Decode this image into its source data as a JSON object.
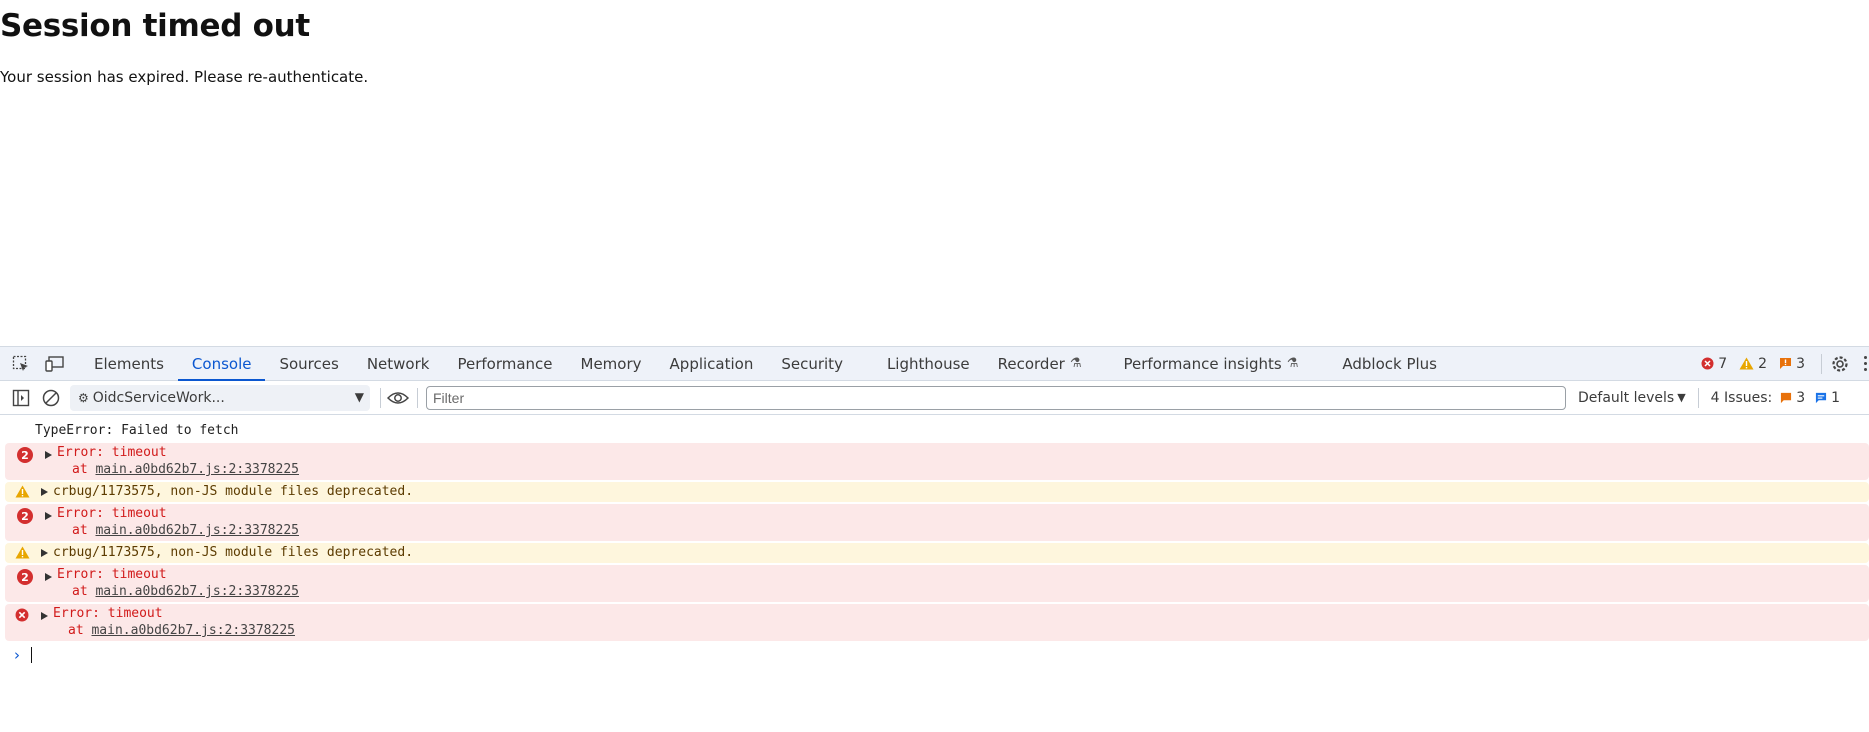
{
  "page": {
    "title": "Session timed out",
    "message": "Your session has expired. Please re-authenticate."
  },
  "devtools": {
    "tabs": [
      {
        "label": "Elements"
      },
      {
        "label": "Console",
        "active": true
      },
      {
        "label": "Sources"
      },
      {
        "label": "Network"
      },
      {
        "label": "Performance"
      },
      {
        "label": "Memory"
      },
      {
        "label": "Application"
      },
      {
        "label": "Security"
      },
      {
        "label": "Lighthouse"
      },
      {
        "label": "Recorder",
        "experimental": true
      },
      {
        "label": "Performance insights",
        "experimental": true
      },
      {
        "label": "Adblock Plus"
      }
    ],
    "counters": {
      "errors": "7",
      "warnings": "2",
      "issues": "3"
    },
    "toolbar": {
      "context": "OidcServiceWork...",
      "filter_placeholder": "Filter",
      "levels": "Default levels",
      "issues_label": "4 Issues:",
      "issues_warn": "3",
      "issues_info": "1"
    },
    "colors": {
      "accent": "#0b57d0",
      "error": "#d32f2f",
      "warning": "#e8a600",
      "error_bg": "#fce8e8",
      "warning_bg": "#fef6dd"
    },
    "console": {
      "plain_line": "TypeError: Failed to fetch",
      "entries": [
        {
          "kind": "error",
          "count": "2",
          "message": "Error: timeout",
          "at": "at",
          "link": "main.a0bd62b7.js:2:3378225"
        },
        {
          "kind": "warning",
          "message": "crbug/1173575, non-JS module files deprecated."
        },
        {
          "kind": "error",
          "count": "2",
          "message": "Error: timeout",
          "at": "at",
          "link": "main.a0bd62b7.js:2:3378225"
        },
        {
          "kind": "warning",
          "message": "crbug/1173575, non-JS module files deprecated."
        },
        {
          "kind": "error",
          "count": "2",
          "message": "Error: timeout",
          "at": "at",
          "link": "main.a0bd62b7.js:2:3378225"
        },
        {
          "kind": "error",
          "message": "Error: timeout",
          "at": "at",
          "link": "main.a0bd62b7.js:2:3378225"
        }
      ]
    }
  }
}
